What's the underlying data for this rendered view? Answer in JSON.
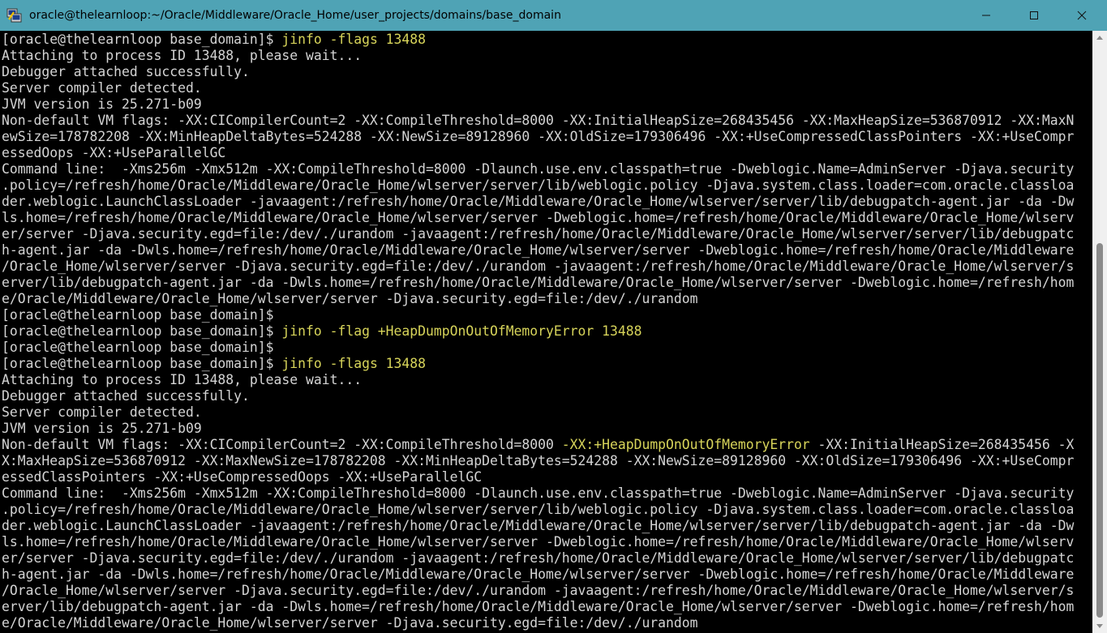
{
  "window": {
    "title": "oracle@thelearnloop:~/Oracle/Middleware/Oracle_Home/user_projects/domains/base_domain",
    "icon": "putty-terminal-icon",
    "controls": {
      "minimize": "minimize-icon",
      "maximize": "maximize-icon",
      "close": "close-icon"
    }
  },
  "colors": {
    "titlebar": "#4fa3b5",
    "terminal_bg": "#000000",
    "terminal_fg": "#d4d4d4",
    "highlight": "#d7d45a"
  },
  "terminal": {
    "lines": [
      {
        "prompt": "[oracle@thelearnloop base_domain]$ ",
        "text": "",
        "cmd": "jinfo -flags 13488",
        "rest": ""
      },
      {
        "prompt": "",
        "text": "Attaching to process ID 13488, please wait...",
        "cmd": "",
        "rest": ""
      },
      {
        "prompt": "",
        "text": "Debugger attached successfully.",
        "cmd": "",
        "rest": ""
      },
      {
        "prompt": "",
        "text": "Server compiler detected.",
        "cmd": "",
        "rest": ""
      },
      {
        "prompt": "",
        "text": "JVM version is 25.271-b09",
        "cmd": "",
        "rest": ""
      },
      {
        "prompt": "",
        "text": "Non-default VM flags: -XX:CICompilerCount=2 -XX:CompileThreshold=8000 -XX:InitialHeapSize=268435456 -XX:MaxHeapSize=536870912 -XX:MaxN",
        "cmd": "",
        "rest": ""
      },
      {
        "prompt": "",
        "text": "ewSize=178782208 -XX:MinHeapDeltaBytes=524288 -XX:NewSize=89128960 -XX:OldSize=179306496 -XX:+UseCompressedClassPointers -XX:+UseCompr",
        "cmd": "",
        "rest": ""
      },
      {
        "prompt": "",
        "text": "essedOops -XX:+UseParallelGC",
        "cmd": "",
        "rest": ""
      },
      {
        "prompt": "",
        "text": "Command line:  -Xms256m -Xmx512m -XX:CompileThreshold=8000 -Dlaunch.use.env.classpath=true -Dweblogic.Name=AdminServer -Djava.security",
        "cmd": "",
        "rest": ""
      },
      {
        "prompt": "",
        "text": ".policy=/refresh/home/Oracle/Middleware/Oracle_Home/wlserver/server/lib/weblogic.policy -Djava.system.class.loader=com.oracle.classloa",
        "cmd": "",
        "rest": ""
      },
      {
        "prompt": "",
        "text": "der.weblogic.LaunchClassLoader -javaagent:/refresh/home/Oracle/Middleware/Oracle_Home/wlserver/server/lib/debugpatch-agent.jar -da -Dw",
        "cmd": "",
        "rest": ""
      },
      {
        "prompt": "",
        "text": "ls.home=/refresh/home/Oracle/Middleware/Oracle_Home/wlserver/server -Dweblogic.home=/refresh/home/Oracle/Middleware/Oracle_Home/wlserv",
        "cmd": "",
        "rest": ""
      },
      {
        "prompt": "",
        "text": "er/server -Djava.security.egd=file:/dev/./urandom -javaagent:/refresh/home/Oracle/Middleware/Oracle_Home/wlserver/server/lib/debugpatc",
        "cmd": "",
        "rest": ""
      },
      {
        "prompt": "",
        "text": "h-agent.jar -da -Dwls.home=/refresh/home/Oracle/Middleware/Oracle_Home/wlserver/server -Dweblogic.home=/refresh/home/Oracle/Middleware",
        "cmd": "",
        "rest": ""
      },
      {
        "prompt": "",
        "text": "/Oracle_Home/wlserver/server -Djava.security.egd=file:/dev/./urandom -javaagent:/refresh/home/Oracle/Middleware/Oracle_Home/wlserver/s",
        "cmd": "",
        "rest": ""
      },
      {
        "prompt": "",
        "text": "erver/lib/debugpatch-agent.jar -da -Dwls.home=/refresh/home/Oracle/Middleware/Oracle_Home/wlserver/server -Dweblogic.home=/refresh/hom",
        "cmd": "",
        "rest": ""
      },
      {
        "prompt": "",
        "text": "e/Oracle/Middleware/Oracle_Home/wlserver/server -Djava.security.egd=file:/dev/./urandom",
        "cmd": "",
        "rest": ""
      },
      {
        "prompt": "[oracle@thelearnloop base_domain]$",
        "text": "",
        "cmd": "",
        "rest": ""
      },
      {
        "prompt": "[oracle@thelearnloop base_domain]$ ",
        "text": "",
        "cmd": "jinfo -flag +HeapDumpOnOutOfMemoryError 13488",
        "rest": ""
      },
      {
        "prompt": "[oracle@thelearnloop base_domain]$",
        "text": "",
        "cmd": "",
        "rest": ""
      },
      {
        "prompt": "[oracle@thelearnloop base_domain]$ ",
        "text": "",
        "cmd": "jinfo -flags 13488",
        "rest": ""
      },
      {
        "prompt": "",
        "text": "Attaching to process ID 13488, please wait...",
        "cmd": "",
        "rest": ""
      },
      {
        "prompt": "",
        "text": "Debugger attached successfully.",
        "cmd": "",
        "rest": ""
      },
      {
        "prompt": "",
        "text": "Server compiler detected.",
        "cmd": "",
        "rest": ""
      },
      {
        "prompt": "",
        "text": "JVM version is 25.271-b09",
        "cmd": "",
        "rest": ""
      },
      {
        "prompt": "",
        "text": "Non-default VM flags: -XX:CICompilerCount=2 -XX:CompileThreshold=8000 ",
        "cmd": "-XX:+HeapDumpOnOutOfMemoryError",
        "rest": " -XX:InitialHeapSize=268435456 -X"
      },
      {
        "prompt": "",
        "text": "X:MaxHeapSize=536870912 -XX:MaxNewSize=178782208 -XX:MinHeapDeltaBytes=524288 -XX:NewSize=89128960 -XX:OldSize=179306496 -XX:+UseCompr",
        "cmd": "",
        "rest": ""
      },
      {
        "prompt": "",
        "text": "essedClassPointers -XX:+UseCompressedOops -XX:+UseParallelGC",
        "cmd": "",
        "rest": ""
      },
      {
        "prompt": "",
        "text": "Command line:  -Xms256m -Xmx512m -XX:CompileThreshold=8000 -Dlaunch.use.env.classpath=true -Dweblogic.Name=AdminServer -Djava.security",
        "cmd": "",
        "rest": ""
      },
      {
        "prompt": "",
        "text": ".policy=/refresh/home/Oracle/Middleware/Oracle_Home/wlserver/server/lib/weblogic.policy -Djava.system.class.loader=com.oracle.classloa",
        "cmd": "",
        "rest": ""
      },
      {
        "prompt": "",
        "text": "der.weblogic.LaunchClassLoader -javaagent:/refresh/home/Oracle/Middleware/Oracle_Home/wlserver/server/lib/debugpatch-agent.jar -da -Dw",
        "cmd": "",
        "rest": ""
      },
      {
        "prompt": "",
        "text": "ls.home=/refresh/home/Oracle/Middleware/Oracle_Home/wlserver/server -Dweblogic.home=/refresh/home/Oracle/Middleware/Oracle_Home/wlserv",
        "cmd": "",
        "rest": ""
      },
      {
        "prompt": "",
        "text": "er/server -Djava.security.egd=file:/dev/./urandom -javaagent:/refresh/home/Oracle/Middleware/Oracle_Home/wlserver/server/lib/debugpatc",
        "cmd": "",
        "rest": ""
      },
      {
        "prompt": "",
        "text": "h-agent.jar -da -Dwls.home=/refresh/home/Oracle/Middleware/Oracle_Home/wlserver/server -Dweblogic.home=/refresh/home/Oracle/Middleware",
        "cmd": "",
        "rest": ""
      },
      {
        "prompt": "",
        "text": "/Oracle_Home/wlserver/server -Djava.security.egd=file:/dev/./urandom -javaagent:/refresh/home/Oracle/Middleware/Oracle_Home/wlserver/s",
        "cmd": "",
        "rest": ""
      },
      {
        "prompt": "",
        "text": "erver/lib/debugpatch-agent.jar -da -Dwls.home=/refresh/home/Oracle/Middleware/Oracle_Home/wlserver/server -Dweblogic.home=/refresh/hom",
        "cmd": "",
        "rest": ""
      },
      {
        "prompt": "",
        "text": "e/Oracle/Middleware/Oracle_Home/wlserver/server -Djava.security.egd=file:/dev/./urandom",
        "cmd": "",
        "rest": ""
      }
    ]
  }
}
